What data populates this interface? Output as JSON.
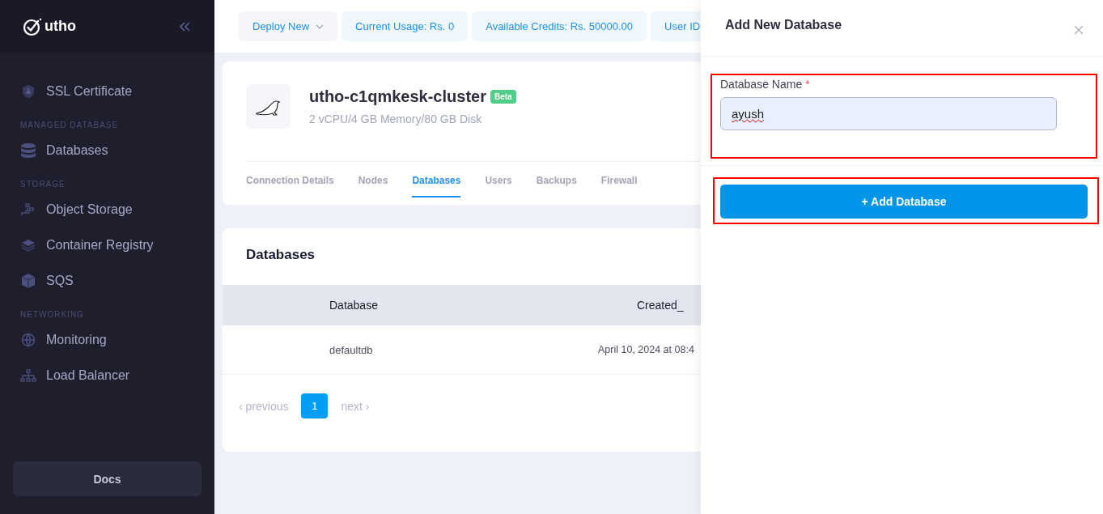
{
  "sidebar": {
    "logo": "utho",
    "groups": [
      {
        "items": [
          {
            "label": "SSL Certificate"
          }
        ]
      },
      {
        "heading": "MANAGED DATABASE",
        "items": [
          {
            "label": "Databases"
          }
        ]
      },
      {
        "heading": "STORAGE",
        "items": [
          {
            "label": "Object Storage"
          },
          {
            "label": "Container Registry"
          },
          {
            "label": "SQS"
          }
        ]
      },
      {
        "heading": "NETWORKING",
        "items": [
          {
            "label": "Monitoring"
          },
          {
            "label": "Load Balancer"
          }
        ]
      }
    ],
    "docs_button": "Docs"
  },
  "top_bar": {
    "deploy_button": "Deploy New",
    "stats": [
      "Current Usage: Rs. 0",
      "Available Credits: Rs. 50000.00",
      "User ID"
    ]
  },
  "cluster": {
    "name": "utho-c1qmkesk-cluster",
    "badge": "Beta",
    "specs": "2 vCPU/4 GB Memory/80 GB Disk",
    "tabs": [
      {
        "label": "Connection Details",
        "selected": false
      },
      {
        "label": "Nodes",
        "selected": false
      },
      {
        "label": "Databases",
        "selected": true
      },
      {
        "label": "Users",
        "selected": false
      },
      {
        "label": "Backups",
        "selected": false
      },
      {
        "label": "Firewall",
        "selected": false
      }
    ]
  },
  "databases": {
    "title": "Databases",
    "columns": [
      "Database",
      "Created_"
    ],
    "rows": [
      [
        "defaultdb",
        "April 10, 2024 at 08:4"
      ]
    ],
    "pagination": {
      "previous": "‹ previous",
      "pages": [
        {
          "label": "1",
          "selected": true
        }
      ],
      "next": "next ›"
    }
  },
  "panel": {
    "title": "Add New Database",
    "field": {
      "label": "Database Name",
      "required_mark": "*",
      "value": "ayush",
      "misspelled": true,
      "highlighted": true
    },
    "submit_button": {
      "label": "+ Add Database",
      "highlighted": true
    }
  }
}
